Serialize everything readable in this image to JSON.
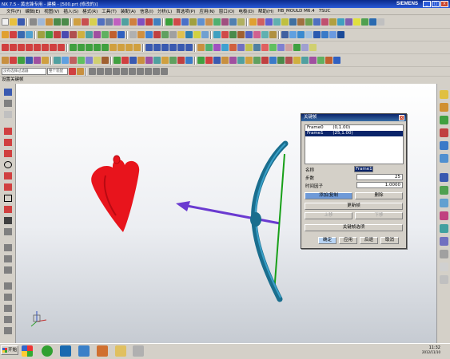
{
  "window": {
    "title": "NX 7.5 - 黄志锋专用 - 建模 - [500.prt (修改的)]",
    "brand": "SIEMENS",
    "controls": [
      "_",
      "□",
      "×"
    ]
  },
  "menu": {
    "items": [
      "文件(F)",
      "编辑(E)",
      "视图(V)",
      "插入(S)",
      "格式(R)",
      "工具(T)",
      "装配(A)",
      "信息(I)",
      "分析(L)",
      "首选项(P)",
      "应用(N)",
      "窗口(O)",
      "电极(D)",
      "帮助(H)",
      "HB_MOULD M6.4",
      "7SUC"
    ]
  },
  "toolbar": {
    "filter_placeholder": "没有选择过滤器",
    "scope_placeholder": "整个装配"
  },
  "panel": {
    "title": "设置关键帧"
  },
  "dialog": {
    "title": "关键帧",
    "frames": [
      {
        "label": "Frame0",
        "value": "(0,1.00)"
      },
      {
        "label": "Frame1",
        "value": "(25,1.00)"
      }
    ],
    "name_label": "名称",
    "name_value": "Frame1",
    "step_label": "步数",
    "step_value": "25",
    "factor_label": "时间因子",
    "factor_value": "1.0000",
    "add_button": "添加/复制",
    "delete_button": "删除",
    "update_button": "更新帧",
    "up_button": "上移",
    "down_button": "下移",
    "keyframe_options_button": "关键帧选项",
    "ok_button": "确定",
    "apply_button": "应用",
    "back_button": "后退",
    "cancel_button": "取消"
  },
  "taskbar": {
    "start_label": "开始",
    "time": "11:32",
    "date": "2012/11/10"
  },
  "colors": {
    "heart": "#e8141c",
    "bow": "#1a6e8e",
    "arrow": "#6a3ad0",
    "string": "#18a018",
    "title_blue": "#0a246a"
  }
}
